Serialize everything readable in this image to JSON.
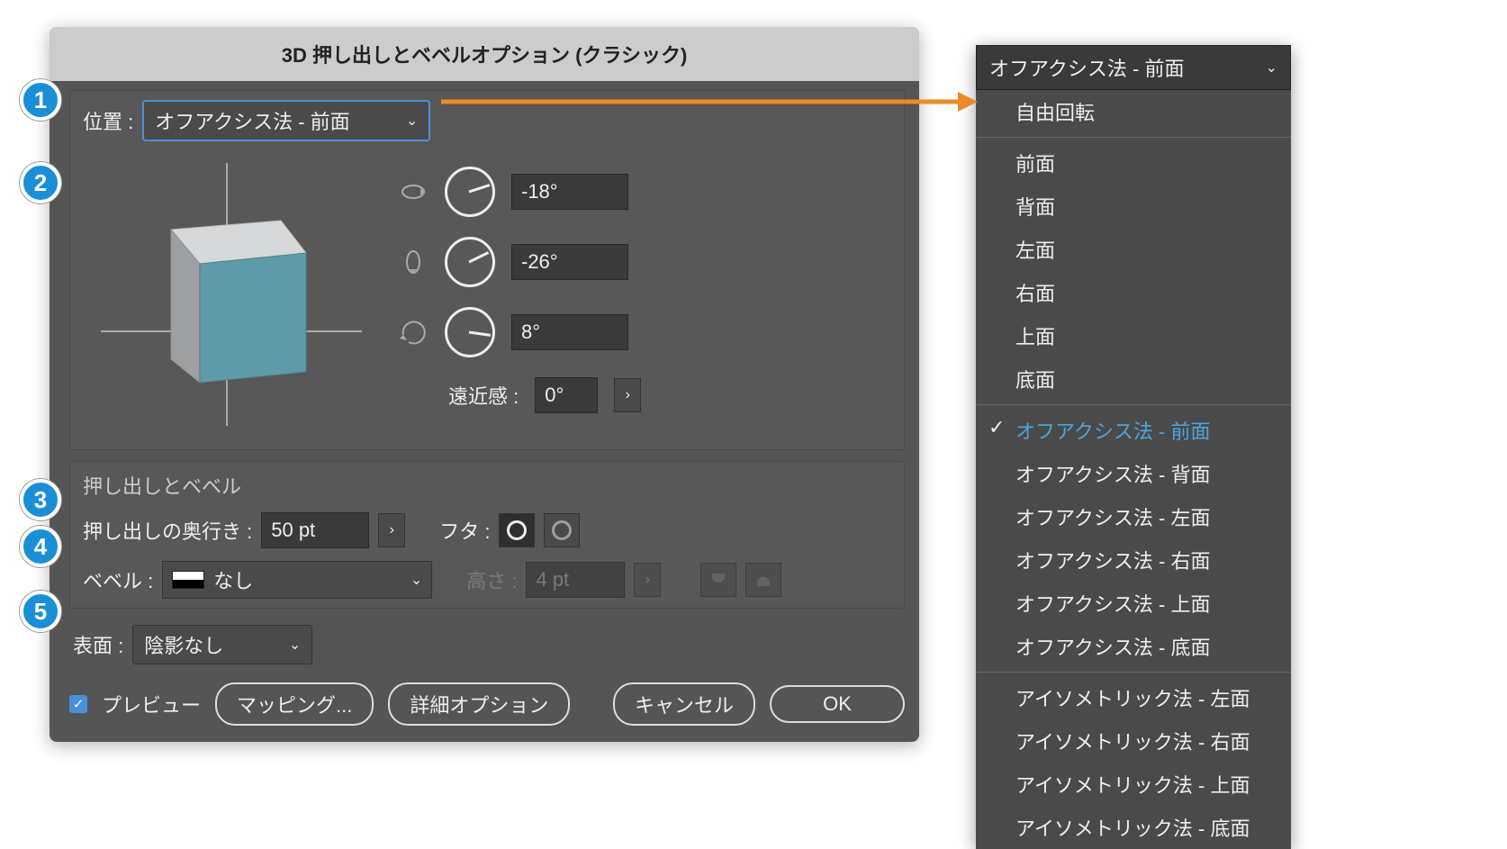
{
  "dialog": {
    "title": "3D 押し出しとベベルオプション (クラシック)",
    "position_label": "位置 :",
    "position_value": "オフアクシス法 - 前面",
    "rot_x": "-18°",
    "rot_y": "-26°",
    "rot_z": "8°",
    "perspective_label": "遠近感 :",
    "perspective_value": "0°",
    "extrude_section": "押し出しとベベル",
    "extrude_depth_label": "押し出しの奥行き :",
    "extrude_depth_value": "50 pt",
    "cap_label": "フタ :",
    "bevel_label": "ベベル :",
    "bevel_value": "なし",
    "height_label": "高さ :",
    "height_value": "4 pt",
    "surface_label": "表面 :",
    "surface_value": "陰影なし",
    "preview_label": "プレビュー",
    "btn_mapping": "マッピング...",
    "btn_more": "詳細オプション",
    "btn_cancel": "キャンセル",
    "btn_ok": "OK"
  },
  "dropdown": {
    "header": "オフアクシス法 - 前面",
    "groups": [
      [
        "自由回転"
      ],
      [
        "前面",
        "背面",
        "左面",
        "右面",
        "上面",
        "底面"
      ],
      [
        "オフアクシス法 - 前面",
        "オフアクシス法 - 背面",
        "オフアクシス法 - 左面",
        "オフアクシス法 - 右面",
        "オフアクシス法 - 上面",
        "オフアクシス法 - 底面"
      ],
      [
        "アイソメトリック法 - 左面",
        "アイソメトリック法 - 右面",
        "アイソメトリック法 - 上面",
        "アイソメトリック法 - 底面"
      ]
    ],
    "selected": "オフアクシス法 - 前面"
  },
  "callouts": [
    "1",
    "2",
    "3",
    "4",
    "5"
  ]
}
